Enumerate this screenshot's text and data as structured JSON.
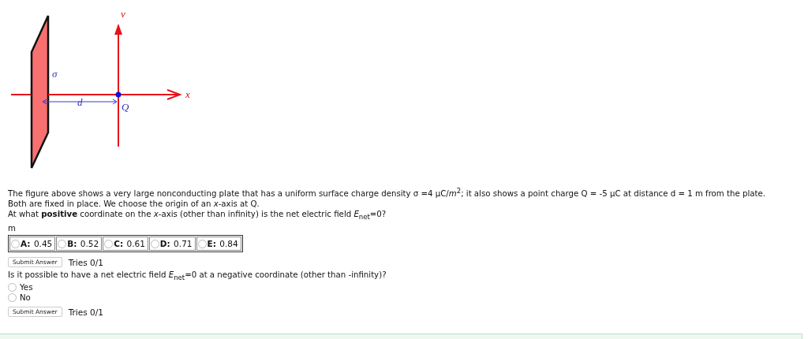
{
  "figure": {
    "labels": [
      {
        "kind": "y",
        "text": "v"
      },
      {
        "kind": "sigma",
        "text": "σ"
      },
      {
        "kind": "d",
        "text": "d"
      },
      {
        "kind": "q",
        "text": "Q"
      },
      {
        "kind": "x",
        "text": "x"
      }
    ]
  },
  "problem": {
    "lines": [
      "The figure above shows a very large nonconducting plate that has a uniform surface charge density σ =4 μC/*m*$^{2}$; it also shows a point charge Q = -5 μC at distance d = 1 m from the plate.",
      "Both are fixed in place. We choose the origin of an *x*-axis at Q.",
      "At what **positive** coordinate on the *x*-axis (other than infinity) is the net electric field *E*$_{net}$=0?"
    ]
  },
  "part1": {
    "unit": "m",
    "choices": [
      {
        "letter": "A:",
        "value": "0.45",
        "selected": false
      },
      {
        "letter": "B:",
        "value": "0.52",
        "selected": false
      },
      {
        "letter": "C:",
        "value": "0.61",
        "selected": false
      },
      {
        "letter": "D:",
        "value": "0.71",
        "selected": false
      },
      {
        "letter": "E:",
        "value": "0.84",
        "selected": false
      }
    ],
    "submit": "Submit Answer",
    "tries": "Tries 0/1"
  },
  "part2": {
    "question": "Is it possible to have a net electric field *E*$_{net}$=0 at a negative coordinate (other than -infinity)?",
    "choices": [
      {
        "label": "Yes",
        "selected": false
      },
      {
        "label": "No",
        "selected": false
      }
    ],
    "submit": "Submit Answer",
    "tries": "Tries 0/1"
  },
  "notice": {
    "kind": "panel"
  }
}
